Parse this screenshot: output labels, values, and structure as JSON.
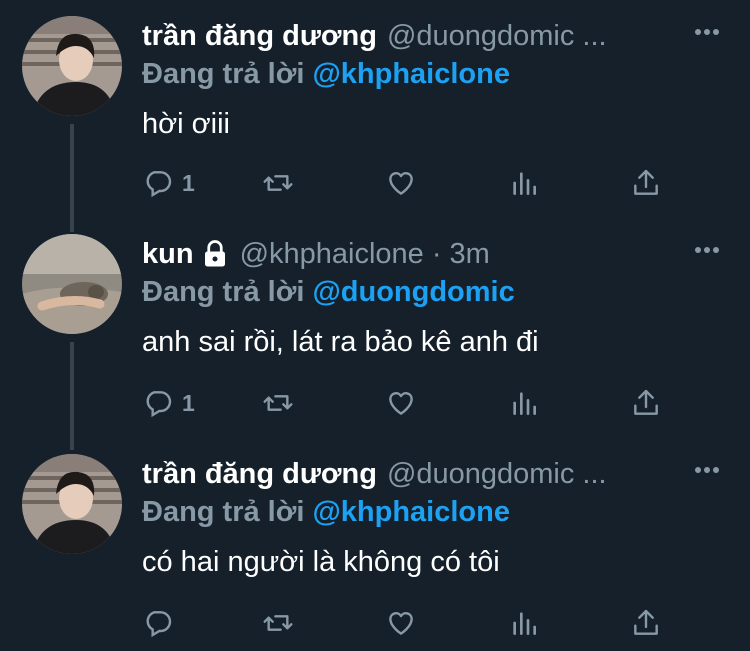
{
  "tweets": [
    {
      "name": "trần đăng dương",
      "handle": "@duongdomic ...",
      "reply_prefix": "Đang trả lời",
      "reply_to": "@khphaiclone",
      "text": "hời ơiii",
      "reply_count": "1",
      "avatar": "man-portrait"
    },
    {
      "name": "kun",
      "locked": true,
      "handle": "@khphaiclone · 3m",
      "reply_prefix": "Đang trả lời",
      "reply_to": "@duongdomic",
      "text": "anh sai rồi, lát ra bảo kê anh đi",
      "reply_count": "1",
      "avatar": "cat-photo"
    },
    {
      "name": "trần đăng dương",
      "handle": "@duongdomic ...",
      "reply_prefix": "Đang trả lời",
      "reply_to": "@khphaiclone",
      "text": "có hai người là không có tôi",
      "reply_count": "",
      "avatar": "man-portrait"
    }
  ],
  "icons": [
    "more-icon",
    "reply-icon",
    "retweet-icon",
    "like-icon",
    "analytics-icon",
    "share-icon",
    "lock-icon"
  ],
  "colors": {
    "background": "#15202b",
    "secondary_text": "#8899a6",
    "mention": "#1da1f2",
    "thread_line": "#38444d"
  }
}
